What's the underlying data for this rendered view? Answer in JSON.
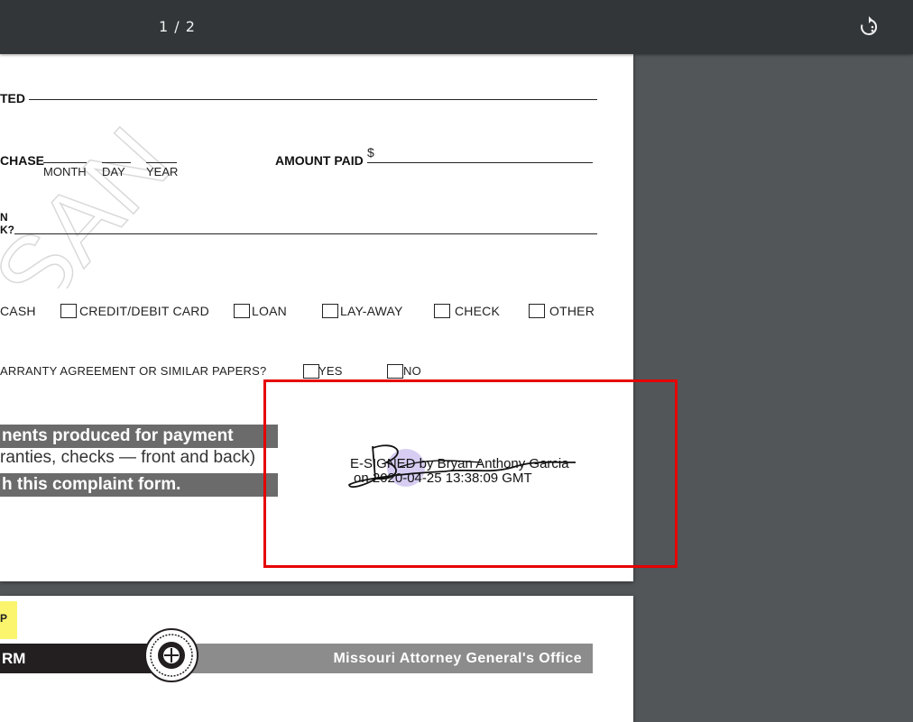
{
  "toolbar": {
    "page_counter": "1 / 2",
    "rotate_icon": "rotate-icon"
  },
  "page1": {
    "watermark": "SAN",
    "row1": {
      "label_fragment": "TED"
    },
    "row2": {
      "label_fragment": "CHASE",
      "month": "MONTH",
      "day": "DAY",
      "year": "YEAR",
      "amount_label": "AMOUNT PAID",
      "currency": "$"
    },
    "row3": {
      "label_line1": "N",
      "label_line2": "K?"
    },
    "payment_methods": [
      "CASH",
      "CREDIT/DEBIT CARD",
      "LOAN",
      "LAY-AWAY",
      "CHECK",
      "OTHER"
    ],
    "warranty": {
      "question": "ARRANTY AGREEMENT OR SIMILAR PAPERS?",
      "yes": "YES",
      "no": "NO"
    },
    "notice": {
      "line1": "nents produced for payment",
      "line2": "ranties, checks — front and back)",
      "line3": "h this complaint form."
    },
    "esignature": {
      "line1": "E-SIGNED by Bryan Anthony Garcia",
      "line2": "on 2020-04-25 13:38:09 GMT"
    }
  },
  "page2": {
    "tag_text": "P",
    "form_fragment": "RM",
    "office": "Missouri Attorney General's Office"
  },
  "colors": {
    "highlight": "#e60000",
    "viewer_bg": "#525659",
    "toolbar_bg": "#323639",
    "tag_yellow": "#fbf56e"
  }
}
